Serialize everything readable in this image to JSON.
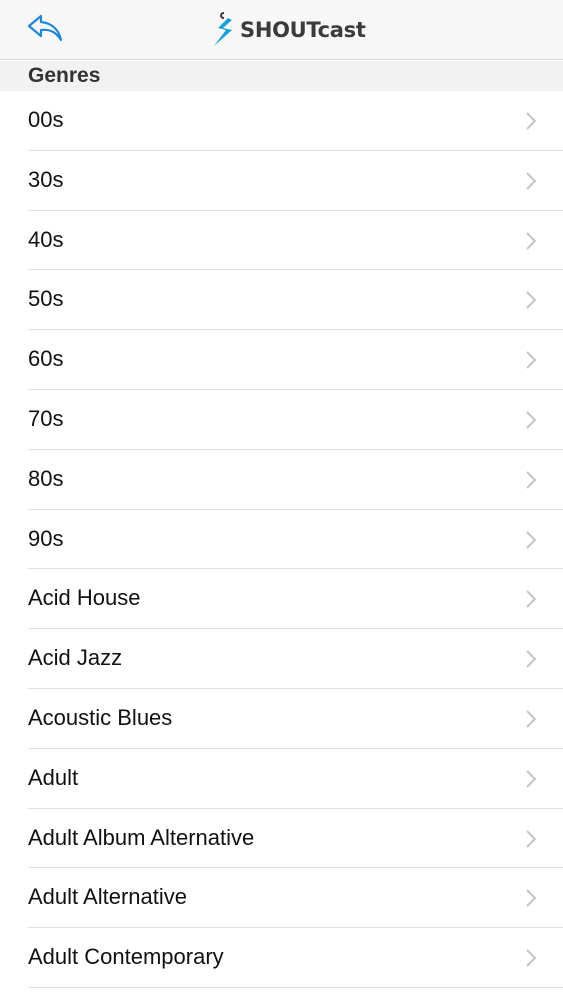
{
  "nav": {
    "back_icon": "back-arrow-icon",
    "logo_text": "SHOUTcast",
    "accent_color": "#1aa0d8"
  },
  "section": {
    "title": "Genres"
  },
  "genres": [
    "00s",
    "30s",
    "40s",
    "50s",
    "60s",
    "70s",
    "80s",
    "90s",
    "Acid House",
    "Acid Jazz",
    "Acoustic Blues",
    "Adult",
    "Adult Album Alternative",
    "Adult Alternative",
    "Adult Contemporary"
  ]
}
